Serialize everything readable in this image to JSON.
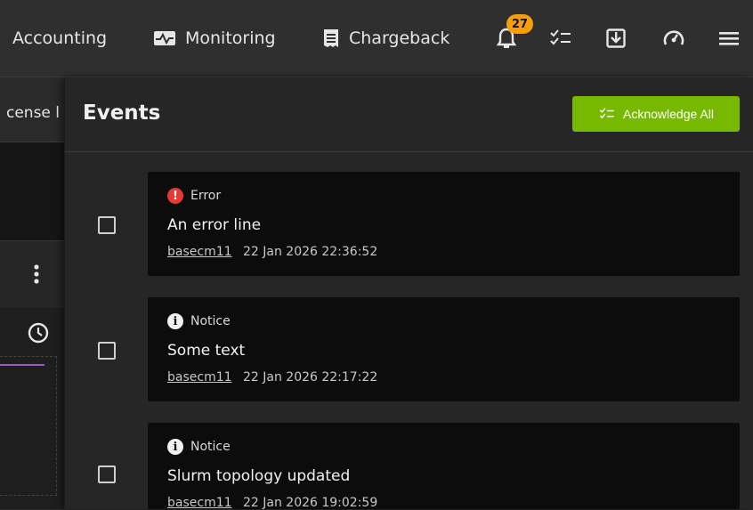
{
  "nav": {
    "accounting": "Accounting",
    "monitoring": "Monitoring",
    "chargeback": "Chargeback",
    "notification_count": "27"
  },
  "background": {
    "tab_label": "cense l"
  },
  "events_panel": {
    "title": "Events",
    "acknowledge_all_label": "Acknowledge All",
    "events": [
      {
        "severity": "Error",
        "message": "An error line",
        "host": "basecm11",
        "timestamp": "22 Jan 2026 22:36:52"
      },
      {
        "severity": "Notice",
        "message": "Some text",
        "host": "basecm11",
        "timestamp": "22 Jan 2026 22:17:22"
      },
      {
        "severity": "Notice",
        "message": "Slurm topology updated",
        "host": "basecm11",
        "timestamp": "22 Jan 2026 19:02:59"
      }
    ]
  },
  "colors": {
    "accent": "#76b900",
    "badge": "#f59e0b",
    "error": "#e53935"
  }
}
